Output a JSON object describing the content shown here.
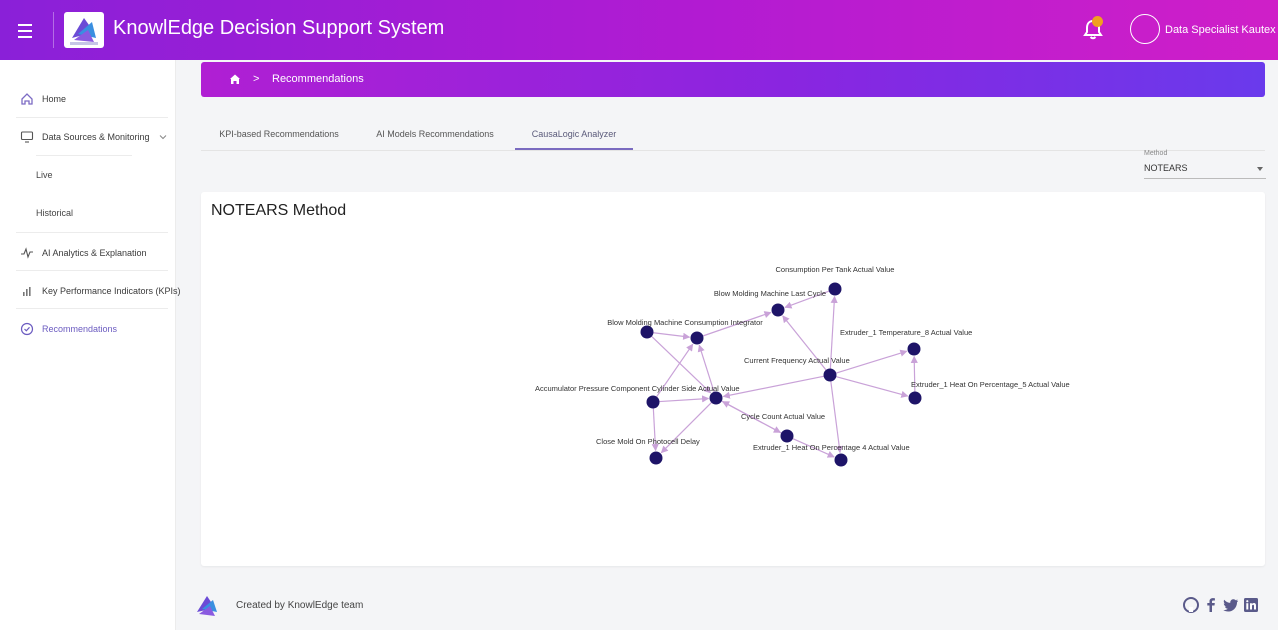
{
  "header": {
    "app_title": "KnowlEdge Decision Support System",
    "user_name": "Data Specialist Kautex",
    "notification_count": "1",
    "brand_color": "#b21bd2"
  },
  "sidebar": {
    "items": [
      {
        "label": "Home",
        "icon": "home-icon"
      },
      {
        "label": "Data Sources & Monitoring",
        "icon": "monitor-icon"
      },
      {
        "label": "Live"
      },
      {
        "label": "Historical"
      },
      {
        "label": "AI Analytics & Explanation",
        "icon": "pulse-icon"
      },
      {
        "label": "Key Performance Indicators (KPIs)",
        "icon": "bar-chart-icon"
      },
      {
        "label": "Recommendations",
        "icon": "check-circle-icon"
      }
    ]
  },
  "breadcrumb": {
    "current": "Recommendations"
  },
  "tabs": [
    {
      "label": "KPI-based Recommendations"
    },
    {
      "label": "AI Models Recommendations"
    },
    {
      "label": "CausaLogic Analyzer",
      "active": true
    }
  ],
  "method_select": {
    "label": "Method",
    "value": "NOTEARS"
  },
  "card": {
    "title": "NOTEARS Method"
  },
  "graph": {
    "node_color": "#1e1468",
    "edge_color": "#c9a2d8",
    "nodes": [
      {
        "id": "n1",
        "label": "Consumption Per Tank Actual Value"
      },
      {
        "id": "n2",
        "label": "Blow Molding Machine Last Cycle"
      },
      {
        "id": "n3",
        "label": "Blow Molding Machine Consumption Integrator"
      },
      {
        "id": "n4",
        "label": "Extruder_1 Temperature_8 Actual Value"
      },
      {
        "id": "n5",
        "label": "Current Frequency Actual Value"
      },
      {
        "id": "n6",
        "label": "Extruder_1 Heat On Percentage_5 Actual Value"
      },
      {
        "id": "n7",
        "label": "Accumulator Pressure Component Cylinder Side Actual Value"
      },
      {
        "id": "n8",
        "label": "Cycle Count Actual Value"
      },
      {
        "id": "n9",
        "label": "Extruder_1 Heat On Percentage 4 Actual Value"
      },
      {
        "id": "n10",
        "label": "Close Mold On Photocell Delay"
      },
      {
        "id": "n11",
        "label": ""
      },
      {
        "id": "n12",
        "label": ""
      },
      {
        "id": "n13",
        "label": ""
      }
    ]
  },
  "footer": {
    "text": "Created by KnowlEdge team",
    "social": [
      "github-icon",
      "facebook-icon",
      "twitter-icon",
      "linkedin-icon"
    ]
  }
}
